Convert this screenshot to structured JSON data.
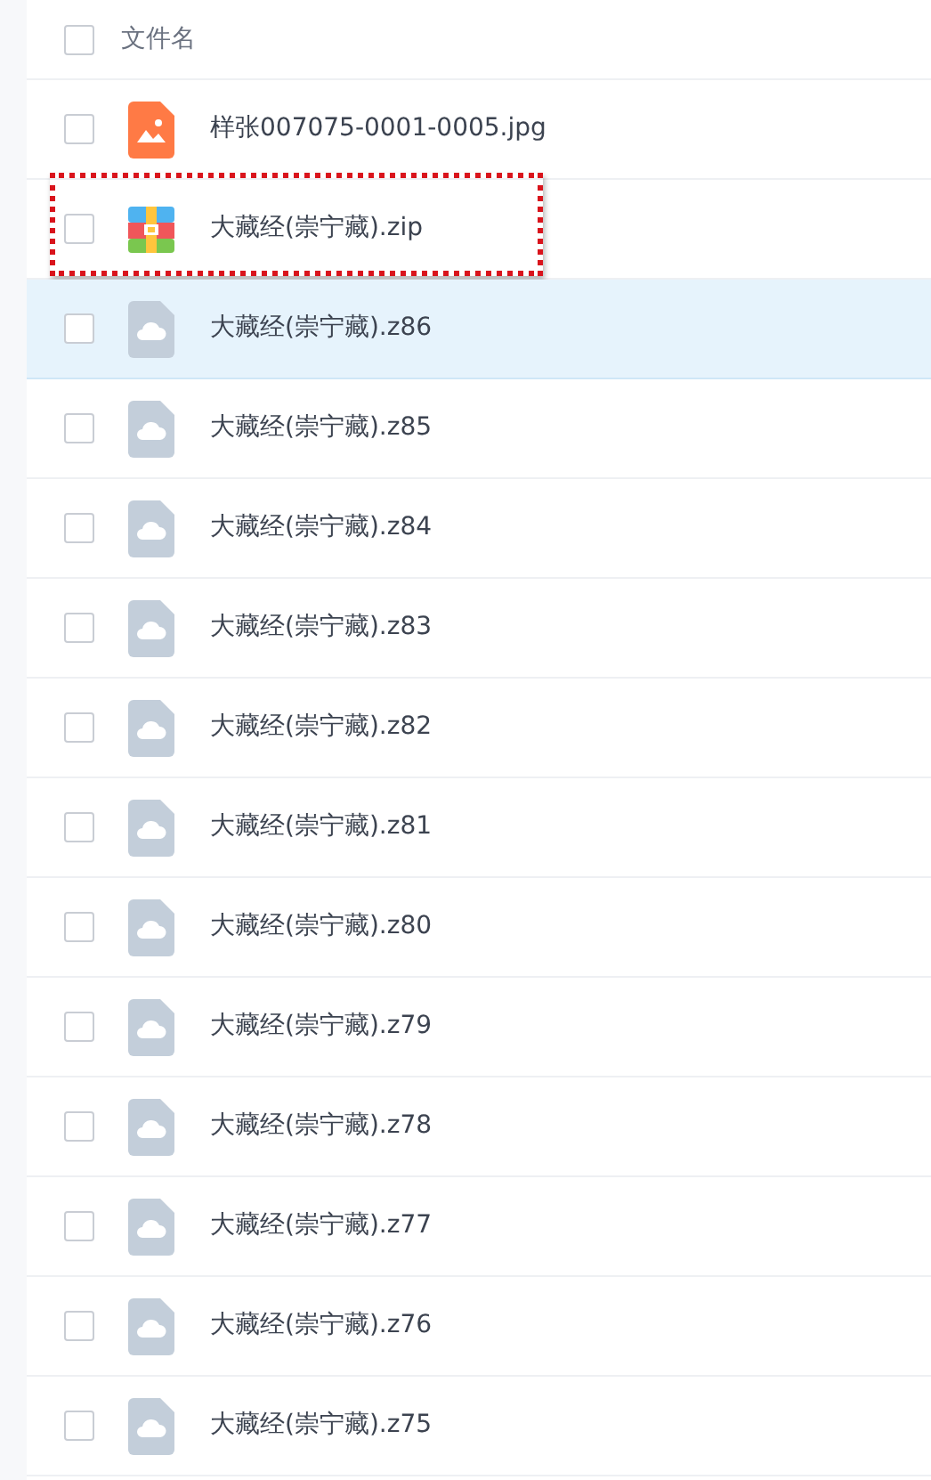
{
  "header": {
    "label": "文件名",
    "checked": false
  },
  "files": [
    {
      "name": "样张007075-0001-0005.jpg",
      "kind": "image",
      "checked": false,
      "hovered": false,
      "outlined": false
    },
    {
      "name": "大藏经(崇宁藏).zip",
      "kind": "archive",
      "checked": false,
      "hovered": false,
      "outlined": true
    },
    {
      "name": "大藏经(崇宁藏).z86",
      "kind": "other",
      "checked": false,
      "hovered": true,
      "outlined": false
    },
    {
      "name": "大藏经(崇宁藏).z85",
      "kind": "other",
      "checked": false,
      "hovered": false,
      "outlined": false
    },
    {
      "name": "大藏经(崇宁藏).z84",
      "kind": "other",
      "checked": false,
      "hovered": false,
      "outlined": false
    },
    {
      "name": "大藏经(崇宁藏).z83",
      "kind": "other",
      "checked": false,
      "hovered": false,
      "outlined": false
    },
    {
      "name": "大藏经(崇宁藏).z82",
      "kind": "other",
      "checked": false,
      "hovered": false,
      "outlined": false
    },
    {
      "name": "大藏经(崇宁藏).z81",
      "kind": "other",
      "checked": false,
      "hovered": false,
      "outlined": false
    },
    {
      "name": "大藏经(崇宁藏).z80",
      "kind": "other",
      "checked": false,
      "hovered": false,
      "outlined": false
    },
    {
      "name": "大藏经(崇宁藏).z79",
      "kind": "other",
      "checked": false,
      "hovered": false,
      "outlined": false
    },
    {
      "name": "大藏经(崇宁藏).z78",
      "kind": "other",
      "checked": false,
      "hovered": false,
      "outlined": false
    },
    {
      "name": "大藏经(崇宁藏).z77",
      "kind": "other",
      "checked": false,
      "hovered": false,
      "outlined": false
    },
    {
      "name": "大藏经(崇宁藏).z76",
      "kind": "other",
      "checked": false,
      "hovered": false,
      "outlined": false
    },
    {
      "name": "大藏经(崇宁藏).z75",
      "kind": "other",
      "checked": false,
      "hovered": false,
      "outlined": false
    }
  ]
}
